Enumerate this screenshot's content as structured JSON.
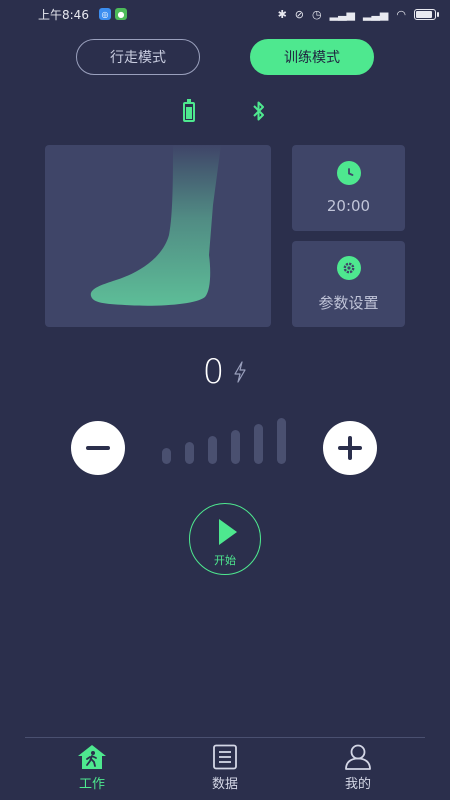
{
  "status_bar": {
    "time": "上午8:46",
    "app_icons": [
      "browser-icon",
      "wechat-icon"
    ],
    "right_icons": [
      "bluetooth-icon",
      "alarm-off-icon",
      "alarm-icon",
      "signal-icon",
      "signal-icon",
      "wifi-icon",
      "battery-icon"
    ]
  },
  "mode_tabs": {
    "walk": "行走模式",
    "train": "训练模式",
    "selected": "train"
  },
  "device": {
    "battery_icon": "battery-icon",
    "bluetooth_icon": "bluetooth-icon",
    "accent_color": "#4ee88f"
  },
  "timer_card": {
    "icon": "clock-icon",
    "value": "20:00"
  },
  "settings_card": {
    "icon": "gear-icon",
    "label": "参数设置"
  },
  "intensity": {
    "value": "0",
    "icon": "lightning-icon"
  },
  "level": {
    "levels_total": 6,
    "levels_active": 0
  },
  "start_button": {
    "label": "开始",
    "icon": "play-icon"
  },
  "bottom_nav": {
    "items": [
      {
        "label": "工作",
        "icon": "home-walk-icon",
        "active": true
      },
      {
        "label": "数据",
        "icon": "list-icon",
        "active": false
      },
      {
        "label": "我的",
        "icon": "user-icon",
        "active": false
      }
    ]
  }
}
